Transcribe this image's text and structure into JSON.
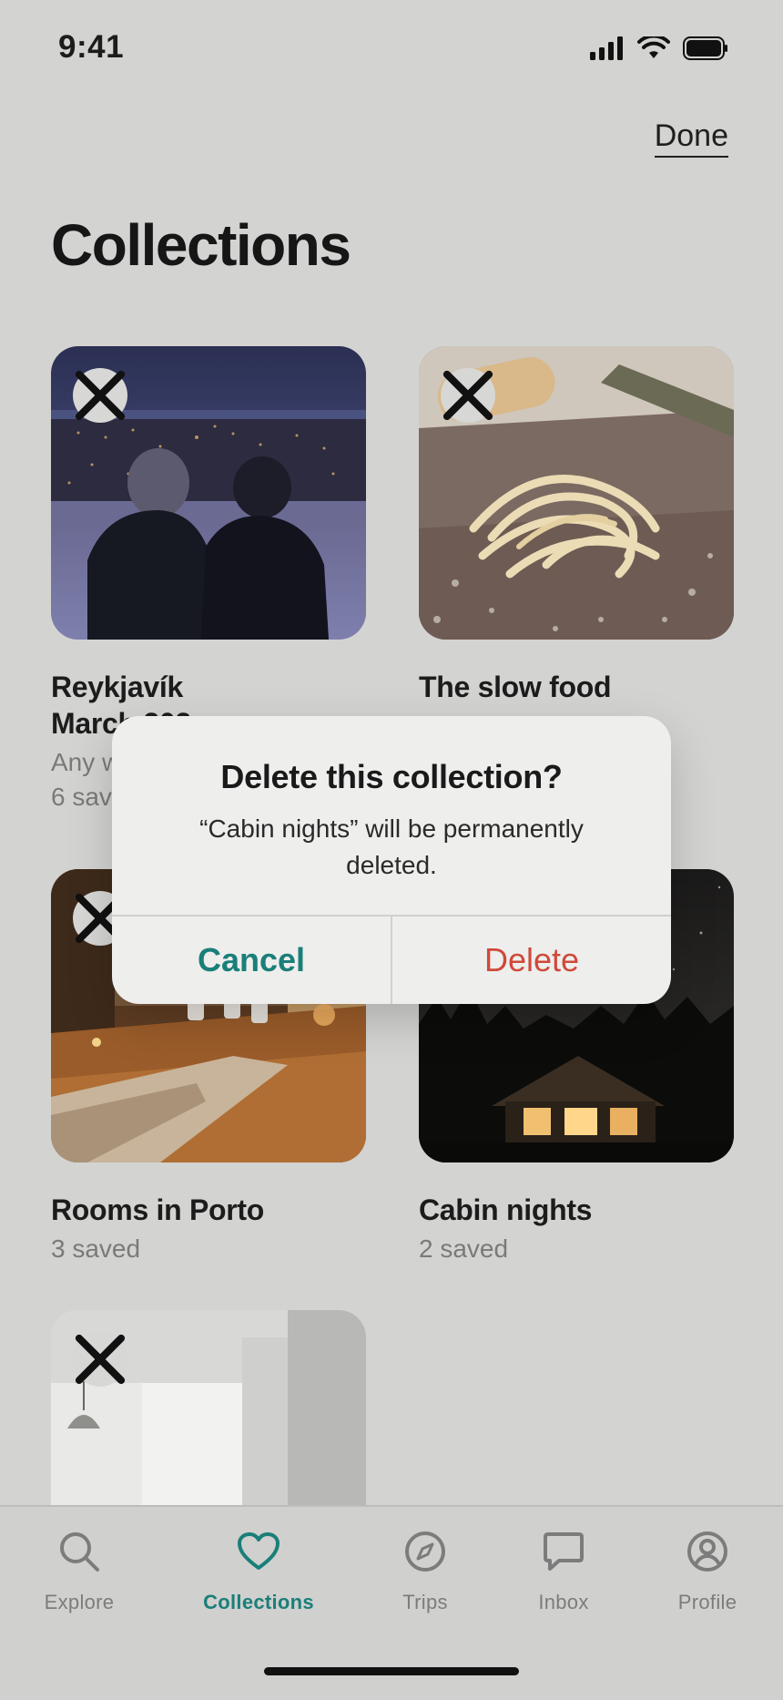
{
  "status_bar": {
    "time": "9:41"
  },
  "header": {
    "done_label": "Done",
    "title": "Collections"
  },
  "collections": [
    {
      "title_line1": "Reykjavík",
      "title_line2": "March 202",
      "subtitle": "Any w",
      "count": "6 sav"
    },
    {
      "title_line1": "The slow food",
      "subtitle": "",
      "count": ""
    },
    {
      "title_line1": "Rooms in Porto",
      "count": "3 saved"
    },
    {
      "title_line1": "Cabin nights",
      "count": "2 saved"
    },
    {
      "title_line1": "",
      "count": ""
    }
  ],
  "dialog": {
    "title": "Delete this collection?",
    "message": "“Cabin nights” will be permanently deleted.",
    "cancel_label": "Cancel",
    "delete_label": "Delete"
  },
  "tab_bar": {
    "items": [
      {
        "label": "Explore",
        "icon": "search-icon"
      },
      {
        "label": "Collections",
        "icon": "heart-icon",
        "active": true
      },
      {
        "label": "Trips",
        "icon": "compass-icon"
      },
      {
        "label": "Inbox",
        "icon": "chat-bubble-icon"
      },
      {
        "label": "Profile",
        "icon": "profile-icon"
      }
    ]
  },
  "colors": {
    "accent": "#1a7f79",
    "destructive": "#cf4a3a",
    "background": "#d3d3d1"
  }
}
